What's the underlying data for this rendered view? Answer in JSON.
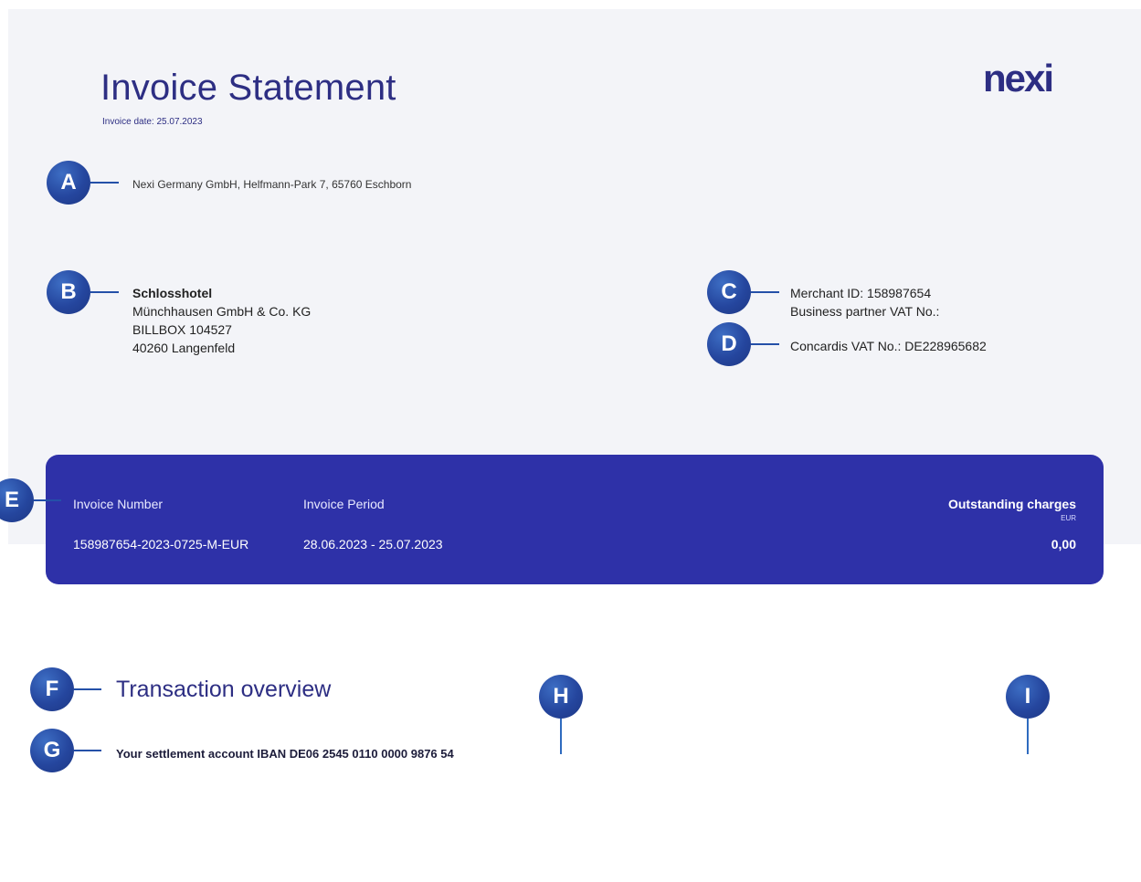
{
  "header": {
    "title": "Invoice Statement",
    "invoice_date": "Invoice date: 25.07.2023",
    "logo": "nexi"
  },
  "markers": {
    "a": "A",
    "b": "B",
    "c": "C",
    "d": "D",
    "e": "E",
    "f": "F",
    "g": "G",
    "h": "H",
    "i": "I"
  },
  "sender": {
    "address": "Nexi Germany GmbH, Helfmann-Park 7, 65760 Eschborn"
  },
  "recipient": {
    "name": "Schlosshotel",
    "line2": "Münchhausen GmbH & Co. KG",
    "line3": "BILLBOX 104527",
    "line4": "40260 Langenfeld"
  },
  "merchant": {
    "merchant_id": "Merchant ID: 158987654",
    "partner_vat": "Business partner VAT No.:",
    "concardis_vat": "Concardis VAT No.: DE228965682"
  },
  "banner": {
    "invoice_number_label": "Invoice Number",
    "invoice_number": "158987654-2023-0725-M-EUR",
    "invoice_period_label": "Invoice Period",
    "invoice_period": "28.06.2023 - 25.07.2023",
    "outstanding_label": "Outstanding charges",
    "currency": "EUR",
    "outstanding_value": "0,00"
  },
  "transactions": {
    "title": "Transaction overview",
    "iban": "Your settlement account IBAN DE06 2545 0110 0000 9876 54"
  },
  "colors": {
    "brand": "#2d2e83",
    "banner": "#2e31a8",
    "marker": "#25469e",
    "background": "#f3f4f8"
  }
}
